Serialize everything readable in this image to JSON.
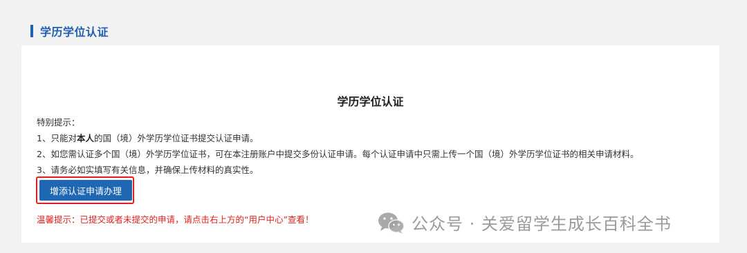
{
  "section": {
    "title": "学历学位认证"
  },
  "card": {
    "title": "学历学位认证",
    "notice_heading": "特别提示：",
    "item1_prefix": "1、只能对",
    "item1_bold": "本人",
    "item1_suffix": "的国（境）外学历学位证书提交认证申请。",
    "item2": "2、如您需认证多个国（境）外学历学位证书，可在本注册账户中提交多份认证申请。每个认证申请中只需上传一个国（境）外学历学位证书的相关申请材料。",
    "item3": "3、请务必如实填写有关信息，并确保上传材料的真实性。",
    "add_button_label": "增添认证申请办理",
    "warm_tip": "温馨提示：已提交或者未提交的申请，请点击右上方的“用户中心”查看！"
  },
  "watermark": {
    "icon": "wechat-icon",
    "text": "公众号 · 关爱留学生成长百科全书"
  },
  "colors": {
    "accent_blue": "#1f5fb4",
    "button_blue": "#1f66b3",
    "highlight_red": "#e02020",
    "page_bg": "#f2f2f2"
  }
}
